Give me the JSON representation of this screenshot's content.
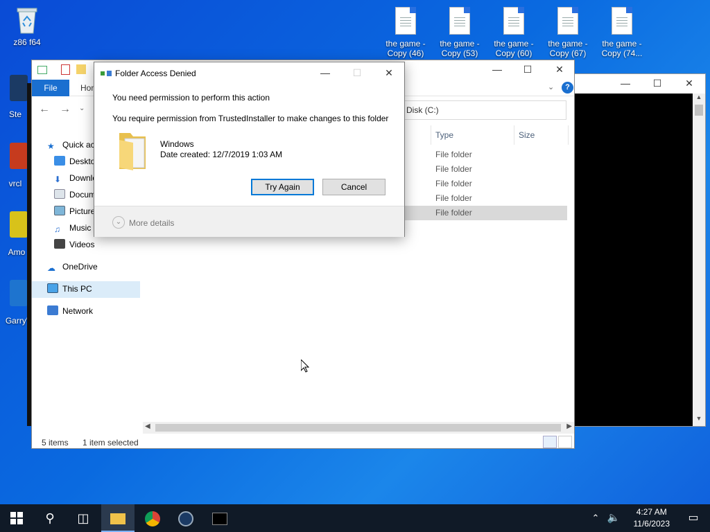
{
  "desktop": {
    "icons": [
      {
        "label": "z86 f64"
      },
      {
        "label": "Ste"
      },
      {
        "label": "vrcl"
      },
      {
        "label": "Amo"
      },
      {
        "label": "Garry'"
      }
    ],
    "files": [
      {
        "line1": "the game -",
        "line2": "Copy (46)"
      },
      {
        "line1": "the game -",
        "line2": "Copy (53)"
      },
      {
        "line1": "the game -",
        "line2": "Copy (60)"
      },
      {
        "line1": "the game -",
        "line2": "Copy (67)"
      },
      {
        "line1": "the game -",
        "line2": "Copy (74..."
      }
    ]
  },
  "explorer": {
    "ribbon": {
      "file": "File",
      "home": "Hom"
    },
    "address": "Disk (C:)",
    "nav": {
      "quick_access": "Quick ac",
      "desktop": "Deskto",
      "downloads": "Downlo",
      "documents": "Docum",
      "pictures": "Picture",
      "music": "Music",
      "videos": "Videos",
      "onedrive": "OneDrive",
      "this_pc": "This PC",
      "network": "Network"
    },
    "columns": {
      "type": "Type",
      "size": "Size"
    },
    "rows": [
      "File folder",
      "File folder",
      "File folder",
      "File folder",
      "File folder"
    ],
    "status": {
      "items": "5 items",
      "selected": "1 item selected"
    }
  },
  "dialog": {
    "title": "Folder Access Denied",
    "line1": "You need permission to perform this action",
    "line2": "You require permission from TrustedInstaller to make changes to this folder",
    "folder_name": "Windows",
    "date_created": "Date created: 12/7/2019 1:03 AM",
    "try_again": "Try Again",
    "cancel": "Cancel",
    "more_details": "More details"
  },
  "taskbar": {
    "time": "4:27 AM",
    "date": "11/6/2023"
  },
  "colors": {
    "accent": "#0078d7",
    "file_tab": "#1a6fd0",
    "taskbar": "#101a27"
  }
}
